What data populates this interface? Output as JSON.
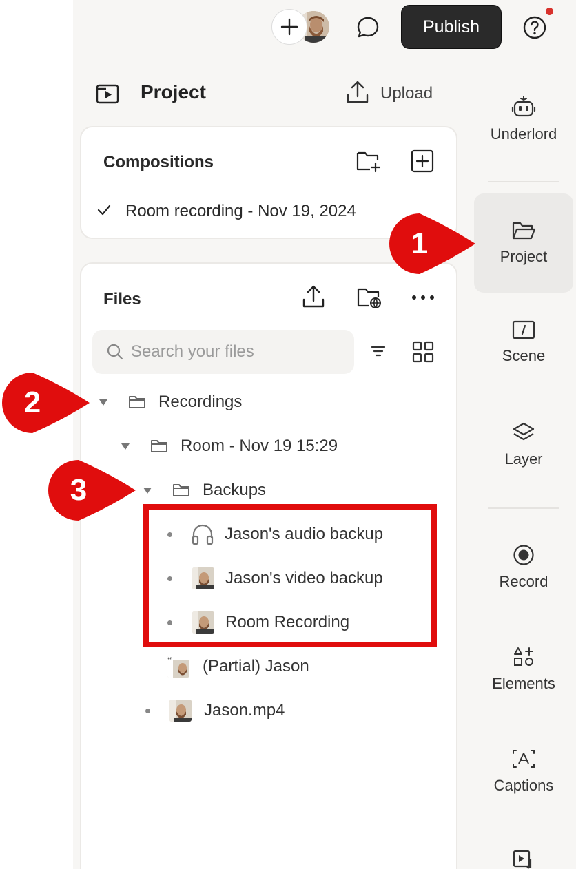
{
  "topbar": {
    "publish_label": "Publish",
    "icons": [
      "plus-icon",
      "avatar",
      "comment-icon",
      "help-icon"
    ],
    "notification_color": "#d8322c"
  },
  "project": {
    "title": "Project",
    "upload_label": "Upload"
  },
  "compositions": {
    "title": "Compositions",
    "items": [
      {
        "label": "Room recording - Nov 19, 2024",
        "selected": true
      }
    ]
  },
  "files": {
    "title": "Files",
    "search_placeholder": "Search your files",
    "tree": [
      {
        "label": "Recordings",
        "type": "folder",
        "expanded": true
      },
      {
        "label": "Room - Nov 19 15:29",
        "type": "folder",
        "expanded": true
      },
      {
        "label": "Backups",
        "type": "folder",
        "expanded": true
      },
      {
        "label": "Jason's audio backup",
        "type": "audio"
      },
      {
        "label": "Jason's video backup",
        "type": "video"
      },
      {
        "label": "Room Recording",
        "type": "video"
      },
      {
        "label": "(Partial) Jason",
        "type": "transcript"
      },
      {
        "label": "Jason.mp4",
        "type": "video"
      }
    ]
  },
  "sidebar": {
    "items": [
      {
        "label": "Underlord",
        "icon": "robot-icon"
      },
      {
        "label": "Project",
        "icon": "folder-open-icon",
        "active": true
      },
      {
        "label": "Scene",
        "icon": "scene-icon"
      },
      {
        "label": "Layer",
        "icon": "layers-icon"
      },
      {
        "label": "Record",
        "icon": "record-icon"
      },
      {
        "label": "Elements",
        "icon": "shapes-icon"
      },
      {
        "label": "Captions",
        "icon": "captions-icon"
      }
    ]
  },
  "callouts": {
    "one": "1",
    "two": "2",
    "three": "3",
    "color": "#e00d0d"
  }
}
